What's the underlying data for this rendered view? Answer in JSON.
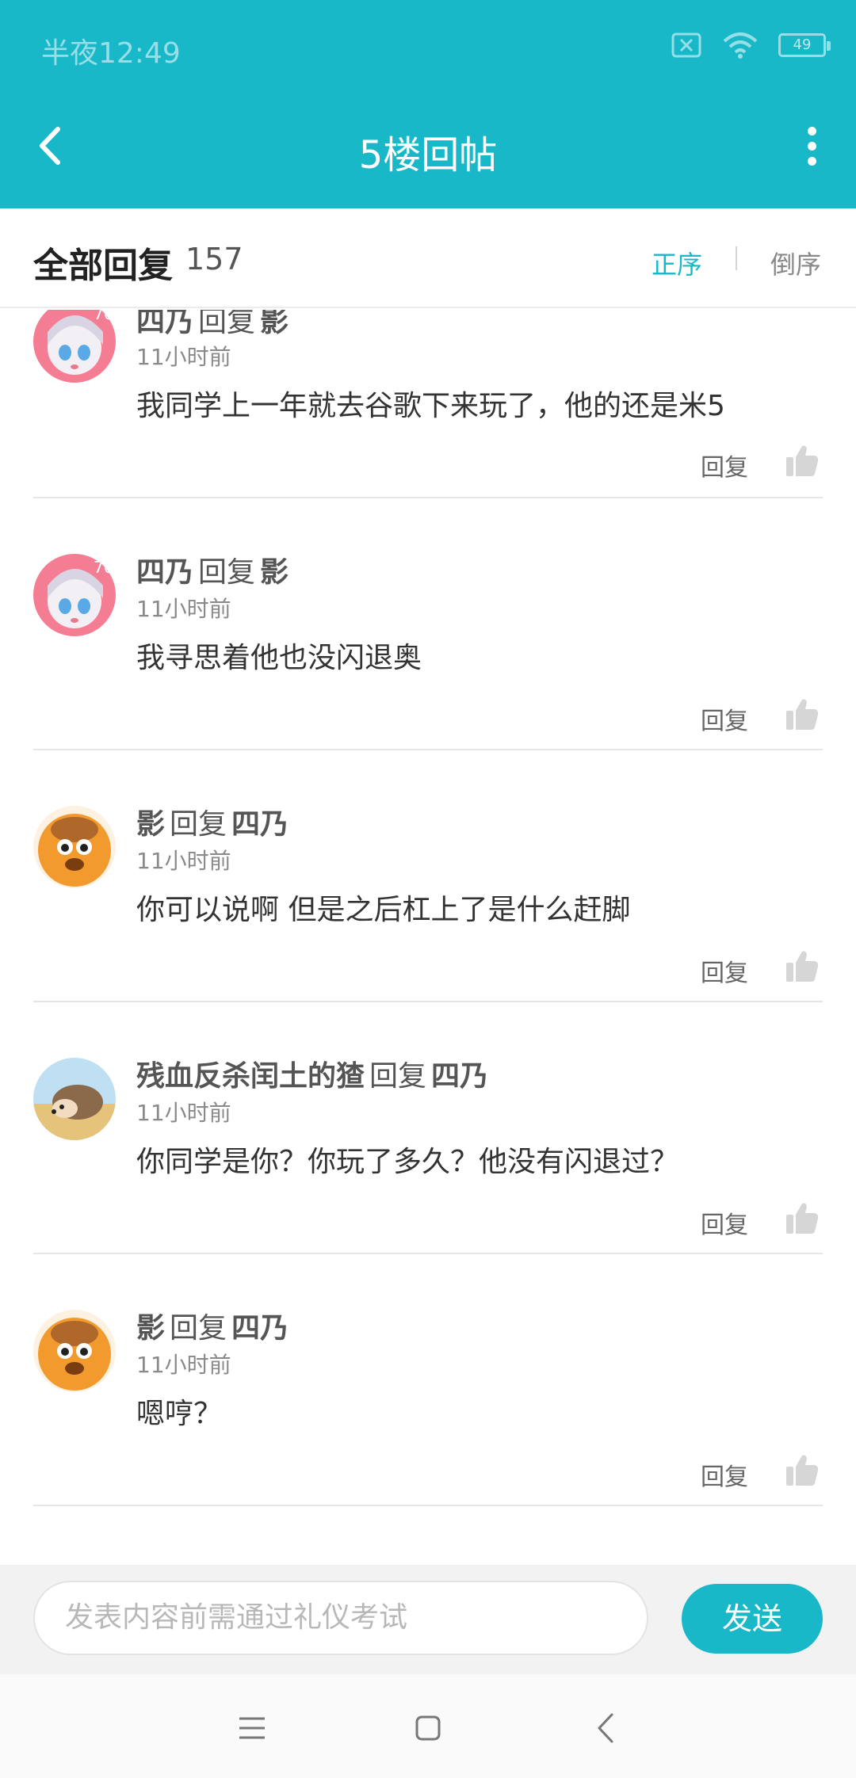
{
  "status_bar": {
    "time": "半夜12:49",
    "battery": "49"
  },
  "toolbar": {
    "title": "5楼回帖"
  },
  "summary": {
    "title": "全部回复",
    "count": "157",
    "sort_asc": "正序",
    "sort_desc": "倒序"
  },
  "reply_keyword": "回复",
  "replies": [
    {
      "author": "四乃",
      "target": "影",
      "time": "11小时前",
      "text": "我同学上一年就去谷歌下来玩了，他的还是米5",
      "reply_label": "回复",
      "avatar": "anime-girl"
    },
    {
      "author": "四乃",
      "target": "影",
      "time": "11小时前",
      "text": "我寻思着他也没闪退奥",
      "reply_label": "回复",
      "avatar": "anime-girl"
    },
    {
      "author": "影",
      "target": "四乃",
      "time": "11小时前",
      "text": "你可以说啊 但是之后杠上了是什么赶脚",
      "reply_label": "回复",
      "avatar": "orange-mascot"
    },
    {
      "author": "残血反杀闰土的猹",
      "target": "四乃",
      "time": "11小时前",
      "text": "你同学是你？你玩了多久？他没有闪退过？",
      "reply_label": "回复",
      "avatar": "hedgehog"
    },
    {
      "author": "影",
      "target": "四乃",
      "time": "11小时前",
      "text": "嗯哼？",
      "reply_label": "回复",
      "avatar": "orange-mascot"
    }
  ],
  "composer": {
    "placeholder": "发表内容前需通过礼仪考试",
    "send_label": "发送"
  },
  "colors": {
    "accent": "#18b8c9"
  }
}
